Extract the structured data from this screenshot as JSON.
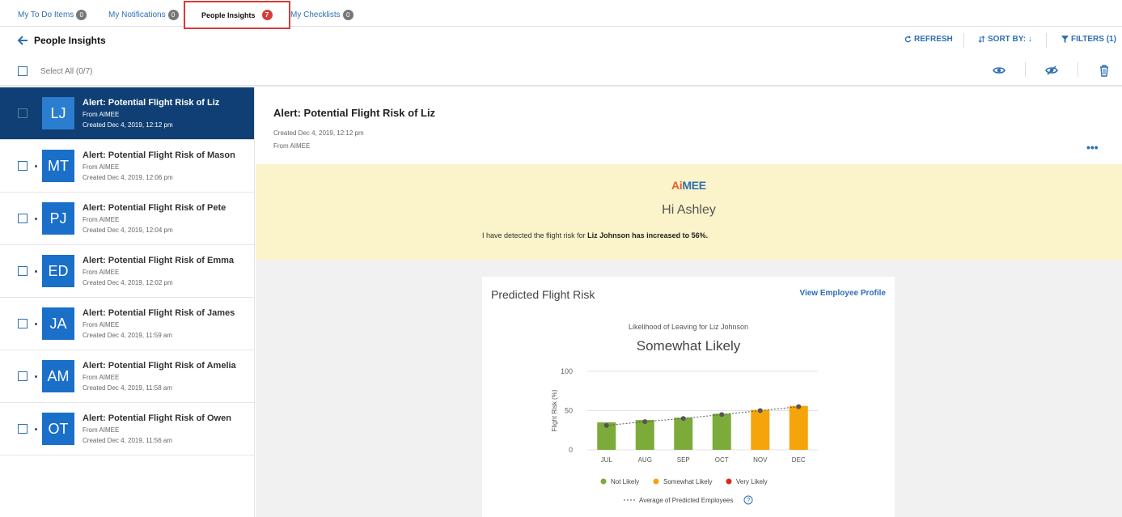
{
  "tabs": [
    {
      "label": "My To Do Items",
      "count": "0"
    },
    {
      "label": "My Notifications",
      "count": "0"
    },
    {
      "label": "People Insights",
      "count": "7"
    },
    {
      "label": "My Checklists",
      "count": "0"
    }
  ],
  "header": {
    "title": "People Insights",
    "refresh": "REFRESH",
    "sort": "SORT BY: ↓",
    "filters": "FILTERS (1)"
  },
  "select_all": "Select All (0/7)",
  "items": [
    {
      "initials": "LJ",
      "title": "Alert: Potential Flight Risk of Liz",
      "from": "From AIMEE",
      "created": "Created Dec 4, 2019, 12:12 pm"
    },
    {
      "initials": "MT",
      "title": "Alert: Potential Flight Risk of Mason",
      "from": "From AIMEE",
      "created": "Created Dec 4, 2019, 12:06 pm"
    },
    {
      "initials": "PJ",
      "title": "Alert: Potential Flight Risk of Pete",
      "from": "From AIMEE",
      "created": "Created Dec 4, 2019, 12:04 pm"
    },
    {
      "initials": "ED",
      "title": "Alert: Potential Flight Risk of Emma",
      "from": "From AIMEE",
      "created": "Created Dec 4, 2019, 12:02 pm"
    },
    {
      "initials": "JA",
      "title": "Alert: Potential Flight Risk of James",
      "from": "From AIMEE",
      "created": "Created Dec 4, 2019, 11:59 am"
    },
    {
      "initials": "AM",
      "title": "Alert: Potential Flight Risk of Amelia",
      "from": "From AIMEE",
      "created": "Created Dec 4, 2019, 11:58 am"
    },
    {
      "initials": "OT",
      "title": "Alert: Potential Flight Risk of Owen",
      "from": "From AIMEE",
      "created": "Created Dec 4, 2019, 11:56 am"
    }
  ],
  "detail": {
    "title": "Alert: Potential Flight Risk of Liz",
    "created": "Created Dec 4, 2019, 12:12 pm",
    "from": "From AIMEE",
    "logo_a": "Ai",
    "logo_rest": "MEE",
    "greeting": "Hi Ashley",
    "msg_pre": "I have detected the flight risk for ",
    "msg_bold": "Liz Johnson has increased to 56%."
  },
  "card": {
    "title": "Predicted Flight Risk",
    "link": "View Employee Profile",
    "subtitle": "Likelihood of Leaving for Liz Johnson",
    "status": "Somewhat Likely"
  },
  "colors": {
    "not_likely": "#7cab3a",
    "somewhat_likely": "#f5a50b",
    "very_likely": "#d9281e",
    "accent": "#2f6fb3"
  },
  "chart_data": {
    "type": "bar",
    "categories": [
      "JUL",
      "AUG",
      "SEP",
      "OCT",
      "NOV",
      "DEC"
    ],
    "values": [
      35,
      38,
      41,
      46,
      51,
      56
    ],
    "average": [
      31,
      36,
      40,
      45,
      50,
      55
    ],
    "bar_classes": [
      "Not Likely",
      "Not Likely",
      "Not Likely",
      "Not Likely",
      "Somewhat Likely",
      "Somewhat Likely"
    ],
    "ylabel": "Flight Risk (%)",
    "ylim": [
      0,
      100
    ],
    "yticks": [
      0,
      50,
      100
    ],
    "grid": true,
    "legend": [
      "Not Likely",
      "Somewhat Likely",
      "Very Likely"
    ],
    "avg_label": "Average of Predicted Employees"
  }
}
